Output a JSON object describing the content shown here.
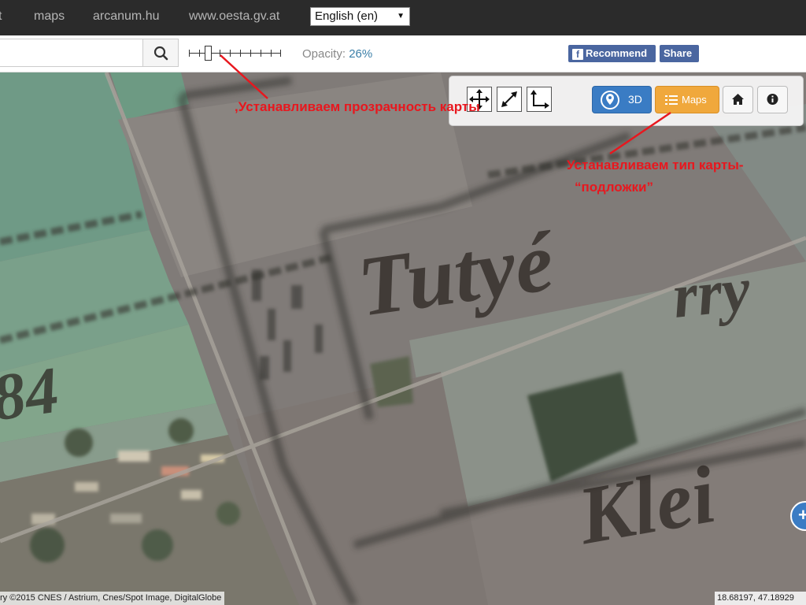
{
  "nav": {
    "items": [
      "t",
      "maps",
      "arcanum.hu",
      "www.oesta.gv.at"
    ],
    "language": "English (en)"
  },
  "toolbar": {
    "search_value": "",
    "opacity_label": "Opacity:",
    "opacity_value": "26%",
    "opacity_fraction": 0.26,
    "recommend_label": "Recommend",
    "share_label": "Share"
  },
  "map_labels": {
    "word1": "Tutyé",
    "word2": "rry",
    "word3": "Klei",
    "number": "84"
  },
  "controls": {
    "btn_3d": "3D",
    "btn_maps": "Maps",
    "colors": {
      "blue": "#3a7cc4",
      "orange": "#f0a83c"
    }
  },
  "annotations": {
    "opacity_note": ",Устанавливаем прозрачность карты",
    "maptype_note_line1": "Устанавливаем тип карты-",
    "maptype_note_line2": "“подложки”"
  },
  "footer": {
    "attribution": "ry ©2015 CNES / Astrium, Cnes/Spot Image, DigitalGlobe",
    "coordinates": "18.68197, 47.18929"
  }
}
